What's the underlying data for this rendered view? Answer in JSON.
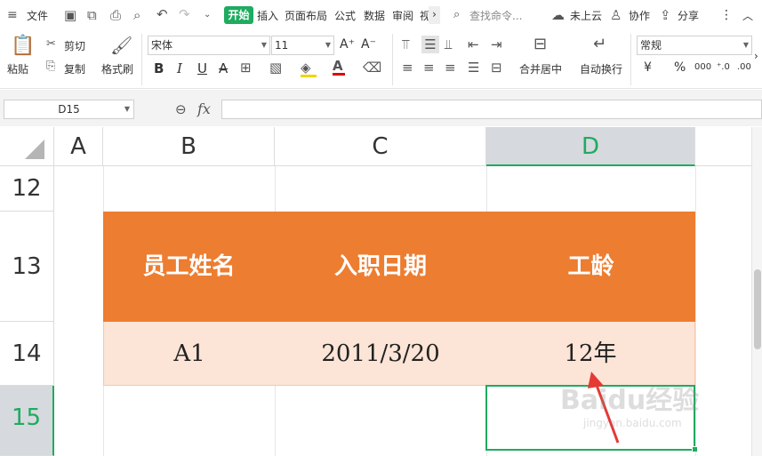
{
  "menu": {
    "file_label": "文件",
    "tabs": [
      "开始",
      "插入",
      "页面布局",
      "公式",
      "数据",
      "审阅",
      "视"
    ],
    "more": "›",
    "search_placeholder": "查找命令...",
    "cloud_label": "未上云",
    "collab_label": "协作",
    "share_label": "分享",
    "kebab": "⋮"
  },
  "ribbon": {
    "paste_label": "粘贴",
    "cut_label": "剪切",
    "copy_label": "复制",
    "format_painter_label": "格式刷",
    "font_name": "宋体",
    "font_size": "11",
    "grow_font": "A⁺",
    "shrink_font": "A⁻",
    "bold": "B",
    "italic": "I",
    "underline": "U",
    "strike": "A",
    "merge_label": "合并居中",
    "wrap_label": "自动换行",
    "number_format": "常规",
    "currency": "¥",
    "percent": "%",
    "thousands": "000",
    "inc_decimal": "⁺.0",
    "dec_decimal": ".00"
  },
  "formula_bar": {
    "cell_ref": "D15",
    "fx": "fx",
    "zoom_icon": "⊖"
  },
  "columns": [
    "A",
    "B",
    "C",
    "D"
  ],
  "rows": [
    "12",
    "13",
    "14",
    "15"
  ],
  "table": {
    "headers": [
      "员工姓名",
      "入职日期",
      "工龄"
    ],
    "row": [
      "A1",
      "2011/3/20",
      "12年"
    ]
  },
  "colors": {
    "accent": "#1fab60",
    "header_fill": "#ed7d31",
    "data_fill": "#fce4d6",
    "arrow": "#e53935"
  },
  "watermark": {
    "brand": "Baidu经验",
    "url": "jingyan.baidu.com"
  }
}
